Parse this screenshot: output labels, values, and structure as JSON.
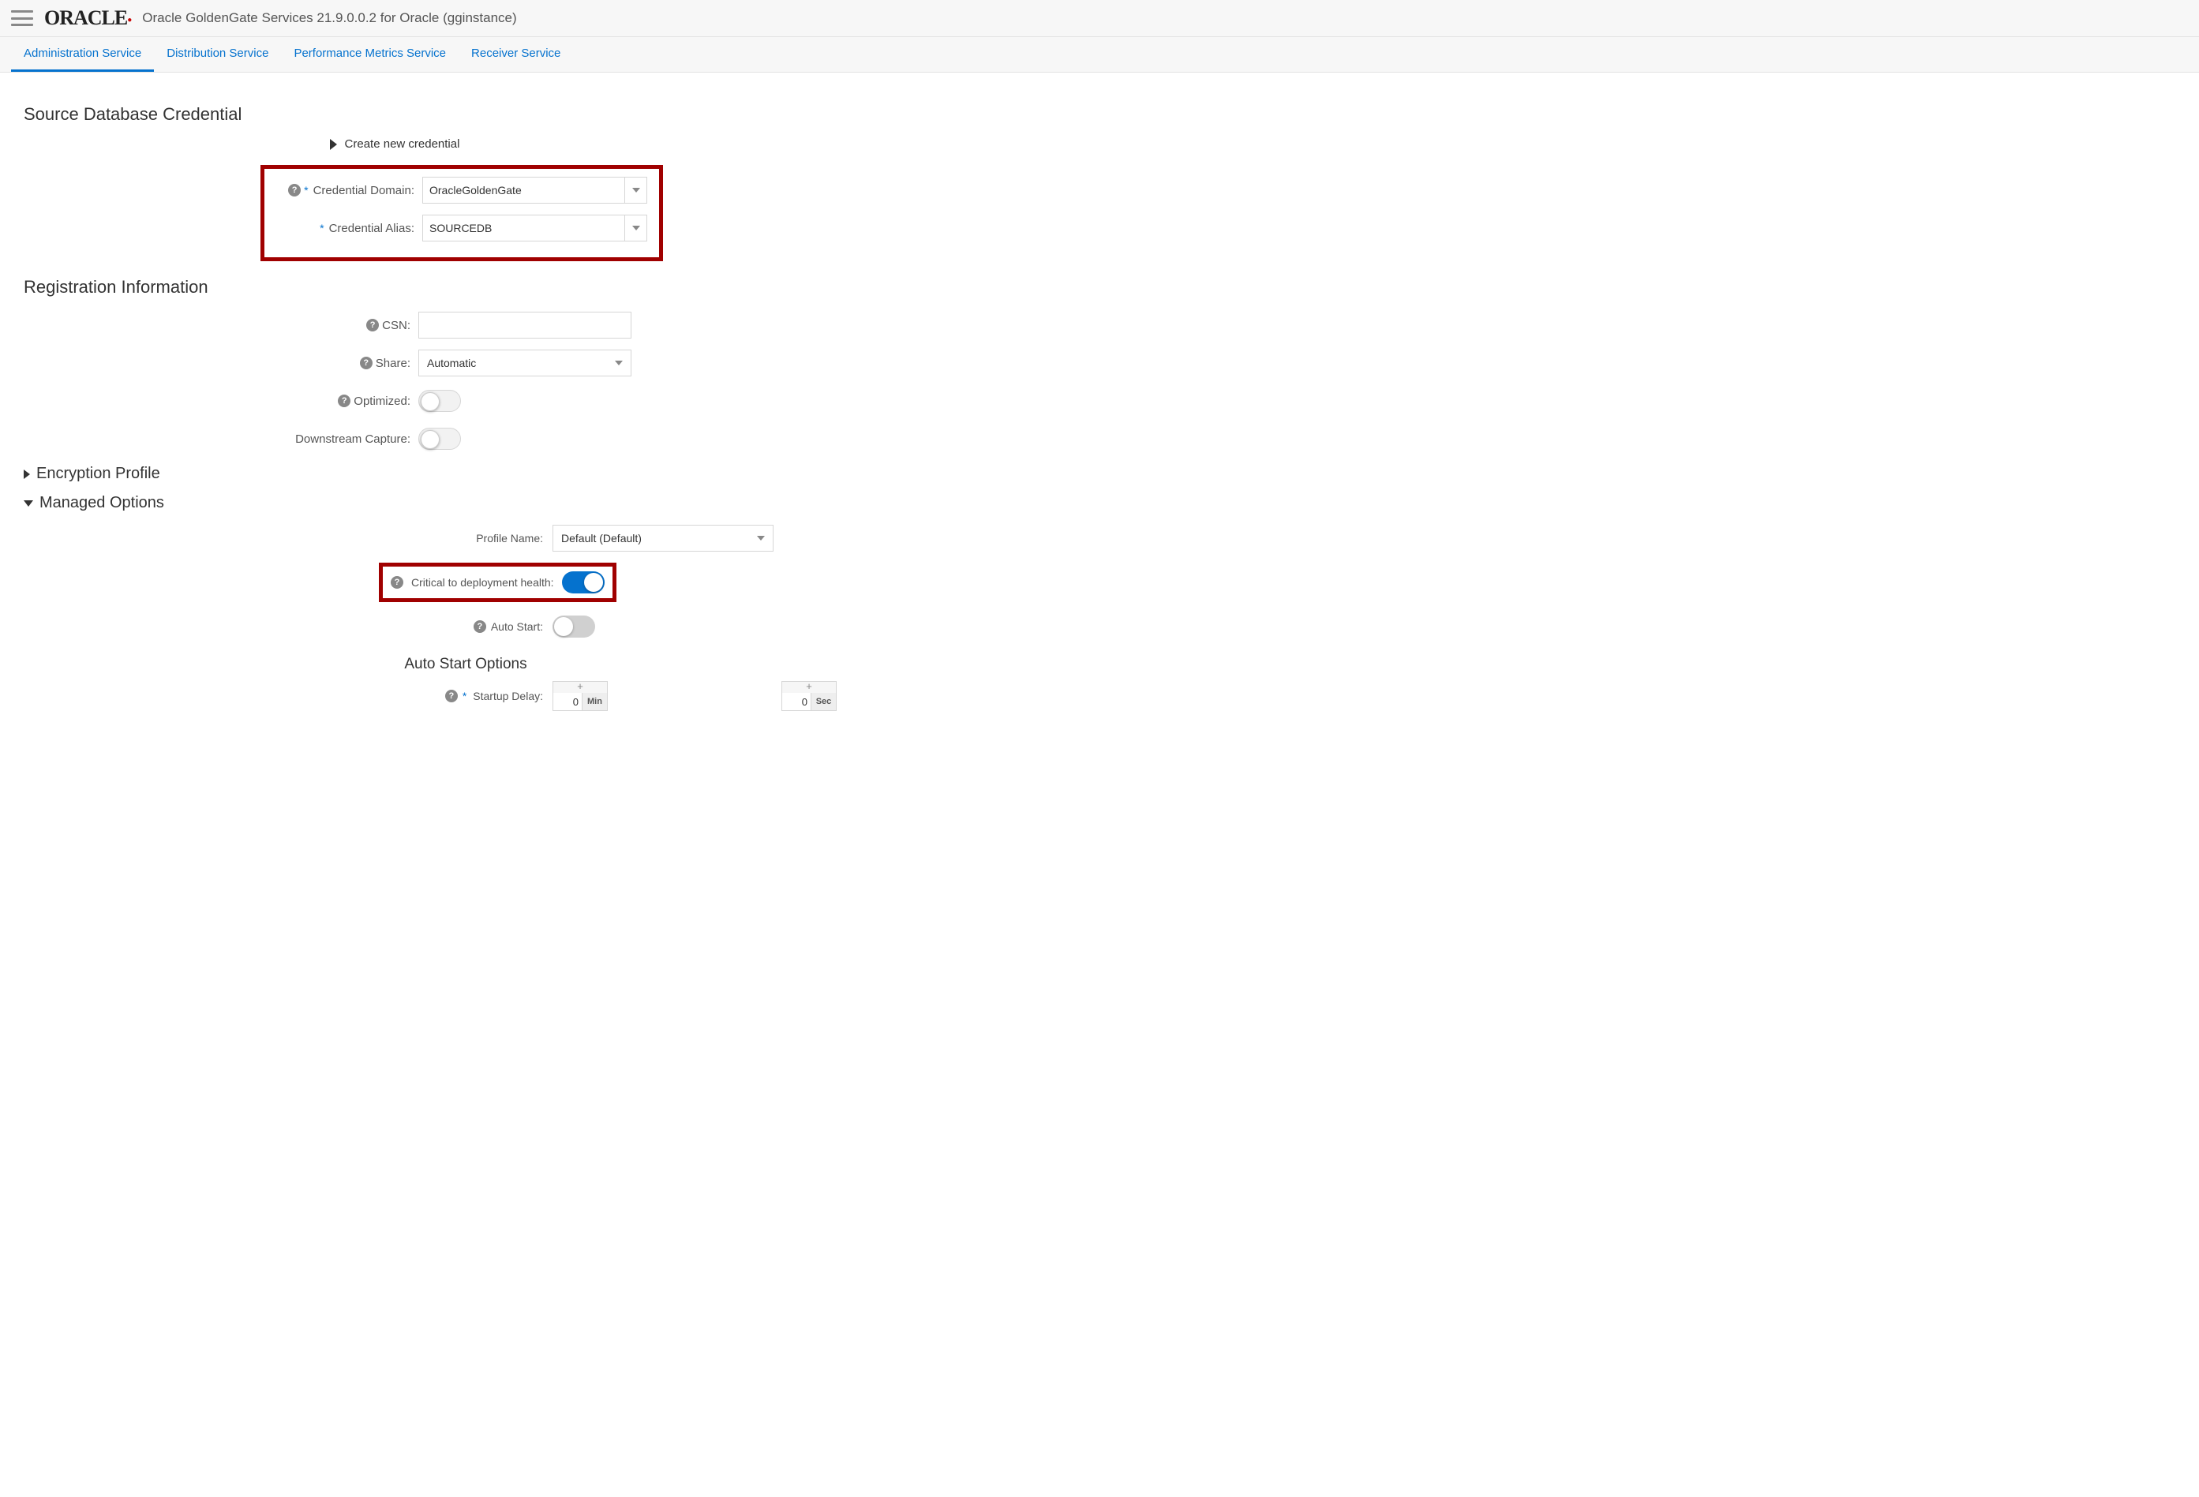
{
  "header": {
    "brand": "ORACLE",
    "title": "Oracle GoldenGate Services 21.9.0.0.2 for Oracle (gginstance)"
  },
  "tabs": [
    {
      "label": "Administration Service",
      "active": true
    },
    {
      "label": "Distribution Service",
      "active": false
    },
    {
      "label": "Performance Metrics Service",
      "active": false
    },
    {
      "label": "Receiver Service",
      "active": false
    }
  ],
  "sections": {
    "source_cred": {
      "title": "Source Database Credential",
      "create_link": "Create new credential",
      "domain_label": "Credential Domain:",
      "domain_value": "OracleGoldenGate",
      "alias_label": "Credential Alias:",
      "alias_value": "SOURCEDB"
    },
    "registration": {
      "title": "Registration Information",
      "csn_label": "CSN:",
      "csn_value": "",
      "share_label": "Share:",
      "share_value": "Automatic",
      "optimized_label": "Optimized:",
      "downstream_label": "Downstream Capture:"
    },
    "encryption": {
      "title": "Encryption Profile"
    },
    "managed": {
      "title": "Managed Options",
      "profile_label": "Profile Name:",
      "profile_value": "Default (Default)",
      "critical_label": "Critical to deployment health:",
      "autostart_label": "Auto Start:",
      "autostart_options": "Auto Start Options",
      "startup_delay_label": "Startup Delay:",
      "stepper_min_val": "0",
      "stepper_min_unit": "Min",
      "stepper_sec_val": "0",
      "stepper_sec_unit": "Sec"
    }
  }
}
